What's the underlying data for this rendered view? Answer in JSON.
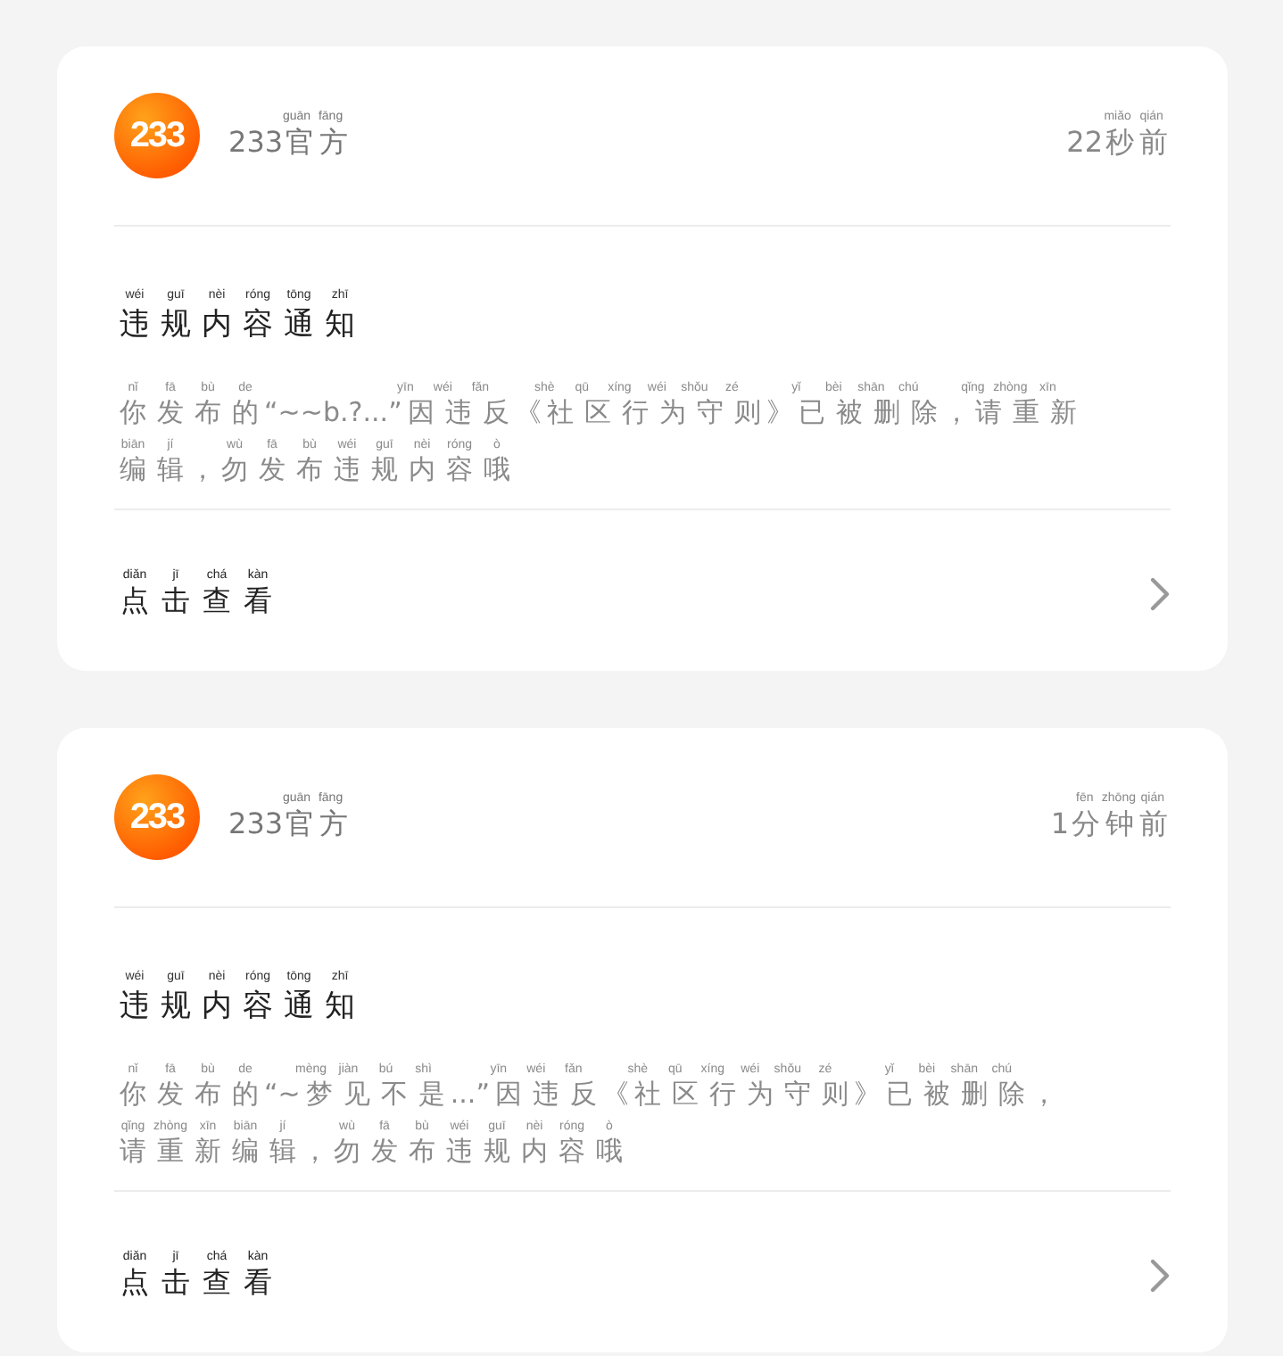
{
  "notifications": [
    {
      "logo": "233",
      "sender": {
        "text": "233官方",
        "pinyin": "guān fāng"
      },
      "time": {
        "text": "22秒前",
        "pinyin": "miǎo qián"
      },
      "title": {
        "text": "违规内容通知",
        "pinyin": "wéi guī nèi róng tōng zhī"
      },
      "message": [
        {
          "text": "你发布的“~~b.?...”因违反《社区行为守则》已被删除，请重新",
          "pinyin": "nǐ fā bù de yīn wéi fǎn shè qū xíng wéi shǒu zé yǐ bèi shān chú qǐng zhòng xīn"
        },
        {
          "text": "编辑，勿发布违规内容哦",
          "pinyin": "biān jí wù fā bù wéi guī nèi róng ò"
        }
      ],
      "action": {
        "text": "点击查看",
        "pinyin": "diǎn jī chá kàn"
      }
    },
    {
      "logo": "233",
      "sender": {
        "text": "233官方",
        "pinyin": "guān fāng"
      },
      "time": {
        "text": "1分钟前",
        "pinyin": "fēn zhōng qián"
      },
      "title": {
        "text": "违规内容通知",
        "pinyin": "wéi guī nèi róng tōng zhī"
      },
      "message": [
        {
          "text": "你发布的“~梦见不是...”因违反《社区行为守则》已被删除，",
          "pinyin": "nǐ fā bù de mèng jiàn bú shì yīn wéi fǎn shè qū xíng wéi shǒu zé yǐ bèi shān chú"
        },
        {
          "text": "请重新编辑，勿发布违规内容哦",
          "pinyin": "qǐng zhòng xīn biān jí wù fā bù wéi guī nèi róng ò"
        }
      ],
      "action": {
        "text": "点击查看",
        "pinyin": "diǎn jī chá kàn"
      }
    }
  ]
}
